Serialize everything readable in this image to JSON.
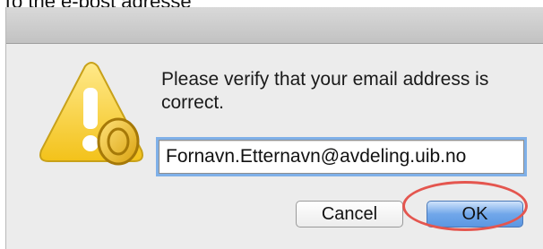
{
  "caption": "To the e-post adresse",
  "dialog": {
    "message": "Please verify that your email address is correct.",
    "email_value": "Fornavn.Etternavn@avdeling.uib.no",
    "cancel_label": "Cancel",
    "ok_label": "OK",
    "alert_icon": "warning-triangle-with-lock-icon"
  },
  "colors": {
    "dialog_background": "#ececec",
    "focus_ring": "#7fb0e8",
    "default_button": "#71a7ea",
    "highlight_ring": "#e4564f"
  }
}
